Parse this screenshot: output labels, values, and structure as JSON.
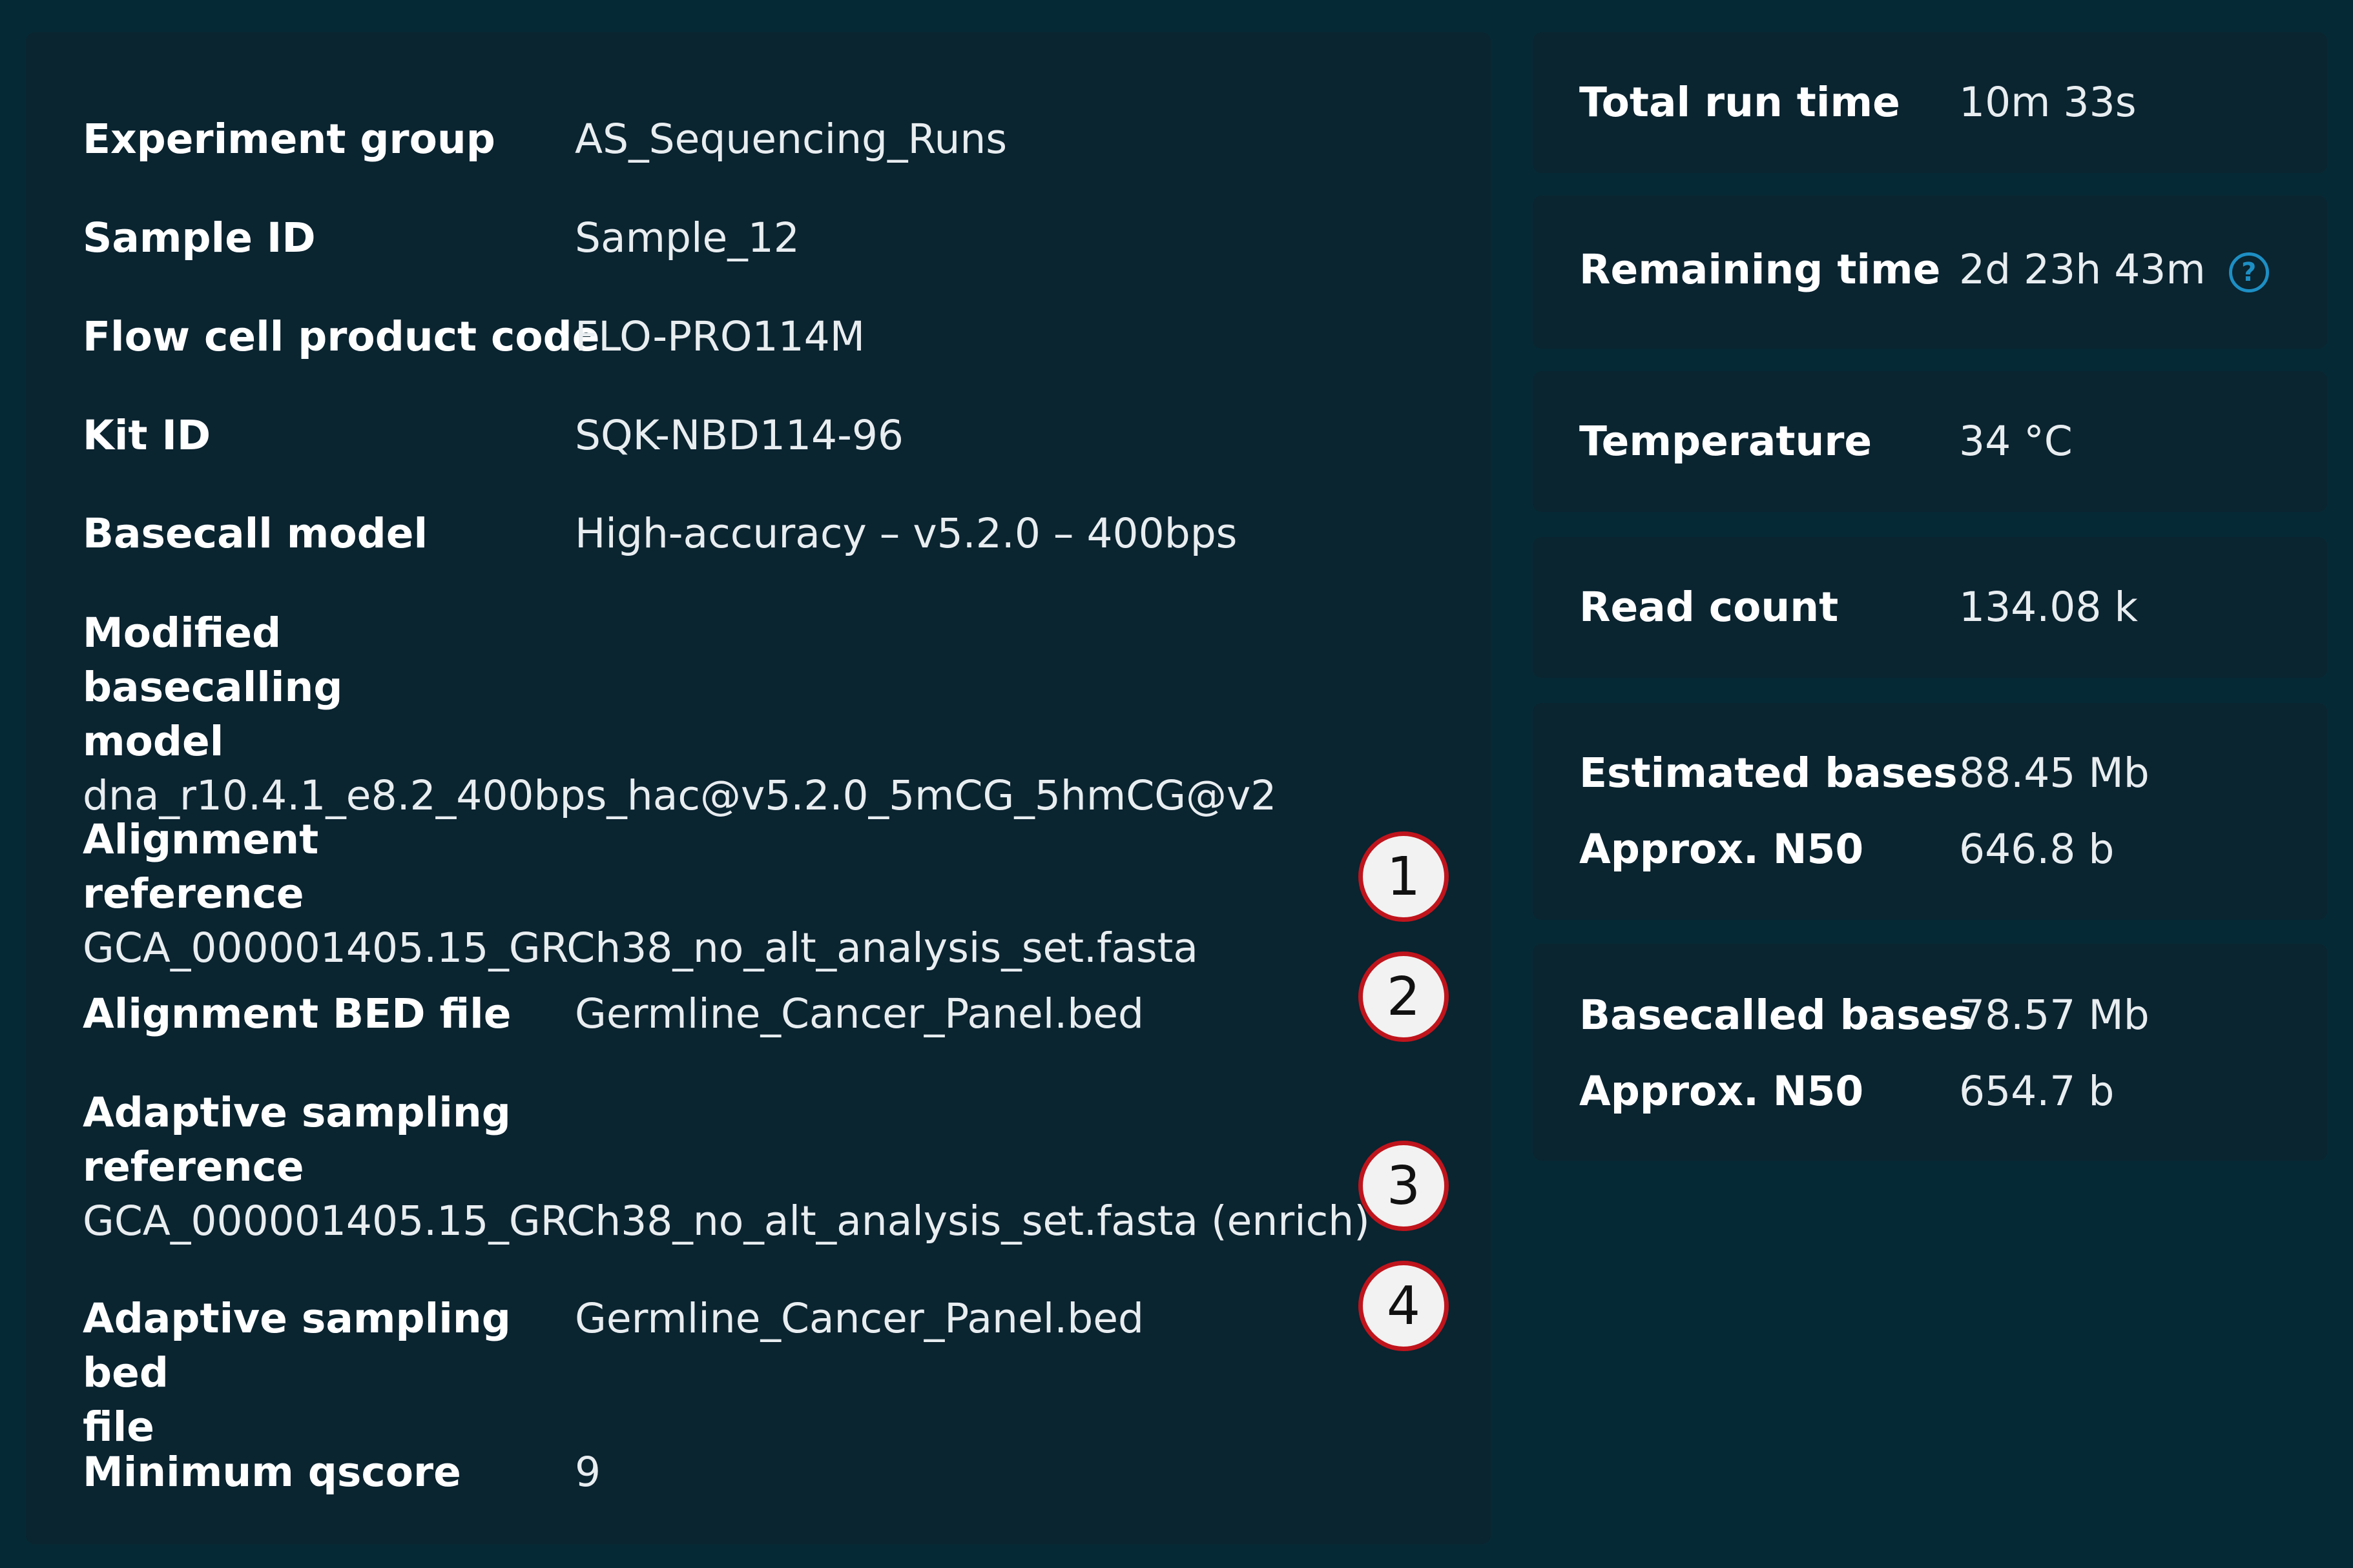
{
  "run_settings": {
    "experiment_group": {
      "label": "Experiment group",
      "value": "AS_Sequencing_Runs"
    },
    "sample_id": {
      "label": "Sample ID",
      "value": "Sample_12"
    },
    "flow_cell_product_code": {
      "label": "Flow cell product code",
      "value": "FLO-PRO114M"
    },
    "kit_id": {
      "label": "Kit ID",
      "value": "SQK-NBD114-96"
    },
    "basecall_model": {
      "label": "Basecall model",
      "value": "High-accuracy – v5.2.0 – 400bps"
    },
    "modified_basecalling_model": {
      "label_line1": "Modified basecalling",
      "label_line2": "model",
      "value": "dna_r10.4.1_e8.2_400bps_hac@v5.2.0_5mCG_5hmCG@v2"
    },
    "alignment_reference": {
      "label": "Alignment reference",
      "value": "GCA_000001405.15_GRCh38_no_alt_analysis_set.fasta"
    },
    "alignment_bed_file": {
      "label": "Alignment BED file",
      "value": "Germline_Cancer_Panel.bed"
    },
    "adaptive_sampling_reference": {
      "label_line1": "Adaptive sampling",
      "label_line2": "reference",
      "value": "GCA_000001405.15_GRCh38_no_alt_analysis_set.fasta (enrich)"
    },
    "adaptive_sampling_bed_file": {
      "label_line1": "Adaptive sampling bed",
      "label_line2": "file",
      "value": "Germline_Cancer_Panel.bed"
    },
    "minimum_qscore": {
      "label": "Minimum qscore",
      "value": "9"
    }
  },
  "callouts": [
    "1",
    "2",
    "3",
    "4"
  ],
  "run_stats": {
    "total_run_time": {
      "label": "Total run time",
      "value": "10m 33s"
    },
    "remaining_time": {
      "label": "Remaining time",
      "value": "2d 23h 43m",
      "help_icon": "?"
    },
    "temperature": {
      "label": "Temperature",
      "value": "34 °C"
    },
    "read_count": {
      "label": "Read count",
      "value": "134.08 k"
    },
    "estimated": {
      "label": "Estimated bases",
      "value": "88.45 Mb",
      "n50_label": "Approx. N50",
      "n50_value": "646.8 b"
    },
    "basecalled": {
      "label": "Basecalled bases",
      "value": "78.57 Mb",
      "n50_label": "Approx. N50",
      "n50_value": "654.7 b"
    }
  },
  "colors": {
    "background": "#062a35",
    "panel": "#0a2430",
    "accent": "#1d8fc4",
    "callout_border": "#c0141c"
  }
}
